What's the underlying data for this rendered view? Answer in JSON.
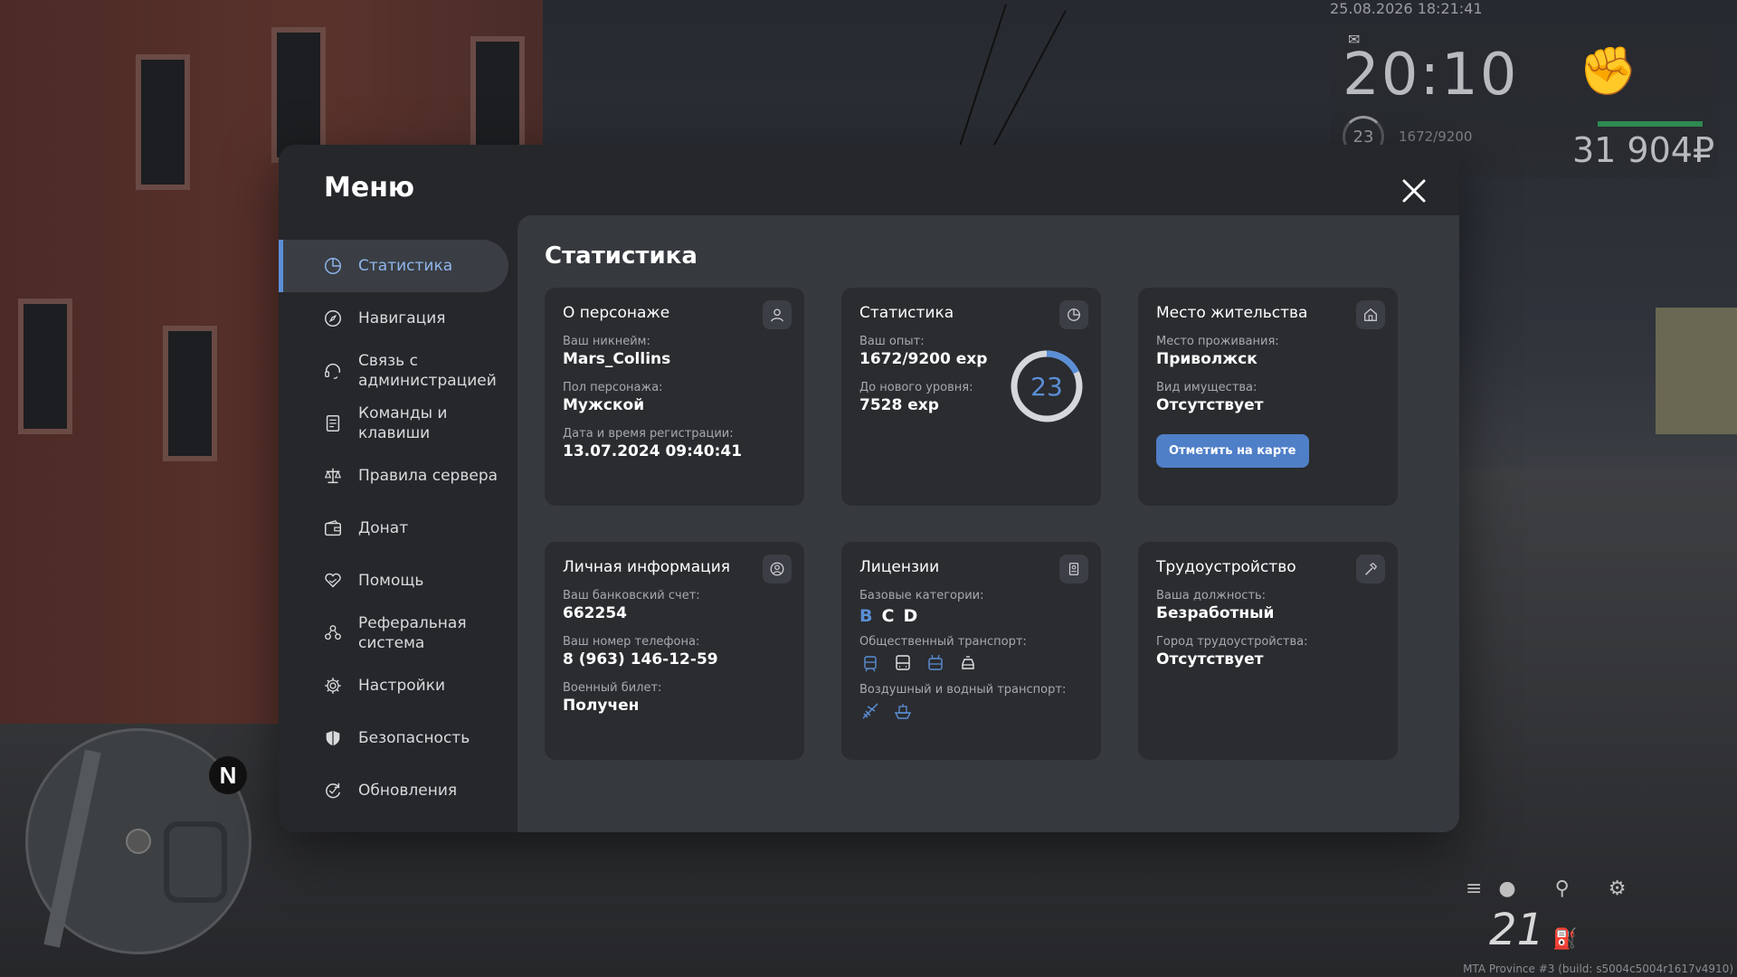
{
  "hud": {
    "datetime": "25.08.2026 18:21:41",
    "time": "20:10",
    "level": "23",
    "exp": "1672/9200",
    "money": "31 904₽",
    "speed": "21",
    "build": "MTA Province #3 (build: s5004c5004r1617v4910)"
  },
  "menu": {
    "title": "Меню",
    "sidebar": [
      {
        "label": "Статистика",
        "icon": "pie-chart-icon",
        "active": true
      },
      {
        "label": "Навигация",
        "icon": "compass-icon"
      },
      {
        "label": "Связь с администрацией",
        "icon": "headset-icon"
      },
      {
        "label": "Команды и клавиши",
        "icon": "document-icon"
      },
      {
        "label": "Правила сервера",
        "icon": "scales-icon"
      },
      {
        "label": "Донат",
        "icon": "wallet-icon"
      },
      {
        "label": "Помощь",
        "icon": "heart-hand-icon"
      },
      {
        "label": "Реферальная система",
        "icon": "people-icon"
      },
      {
        "label": "Настройки",
        "icon": "gear-icon"
      },
      {
        "label": "Безопасность",
        "icon": "shield-icon"
      },
      {
        "label": "Обновления",
        "icon": "refresh-icon"
      }
    ]
  },
  "stats": {
    "title": "Статистика",
    "character": {
      "title": "О персонаже",
      "nick_label": "Ваш никнейм:",
      "nick": "Mars_Collins",
      "gender_label": "Пол персонажа:",
      "gender": "Мужской",
      "reg_label": "Дата и время регистрации:",
      "reg": "13.07.2024 09:40:41"
    },
    "experience": {
      "title": "Статистика",
      "exp_label": "Ваш опыт:",
      "exp": "1672/9200 exp",
      "next_label": "До нового уровня:",
      "next": "7528 exp",
      "level": "23",
      "progress": 0.18
    },
    "residence": {
      "title": "Место жительства",
      "place_label": "Место проживания:",
      "place": "Приволжск",
      "property_label": "Вид имущества:",
      "property": "Отсутствует",
      "button": "Отметить на карте"
    },
    "personal": {
      "title": "Личная информация",
      "bank_label": "Ваш банковский счет:",
      "bank": "662254",
      "phone_label": "Ваш номер телефона:",
      "phone": "8 (963) 146-12-59",
      "military_label": "Военный билет:",
      "military": "Получен"
    },
    "licenses": {
      "title": "Лицензии",
      "base_label": "Базовые категории:",
      "categories": [
        "B",
        "C",
        "D"
      ],
      "public_label": "Общественный транспорт:",
      "air_label": "Воздушный и водный транспорт:"
    },
    "employment": {
      "title": "Трудоустройство",
      "position_label": "Ваша должность:",
      "position": "Безработный",
      "city_label": "Город трудоустройства:",
      "city": "Отсутствует"
    }
  },
  "colors": {
    "accent": "#5b8fd6",
    "button": "#4f7fc7",
    "panel": "#25272b",
    "content": "#36393e",
    "card": "#2a2c30"
  }
}
